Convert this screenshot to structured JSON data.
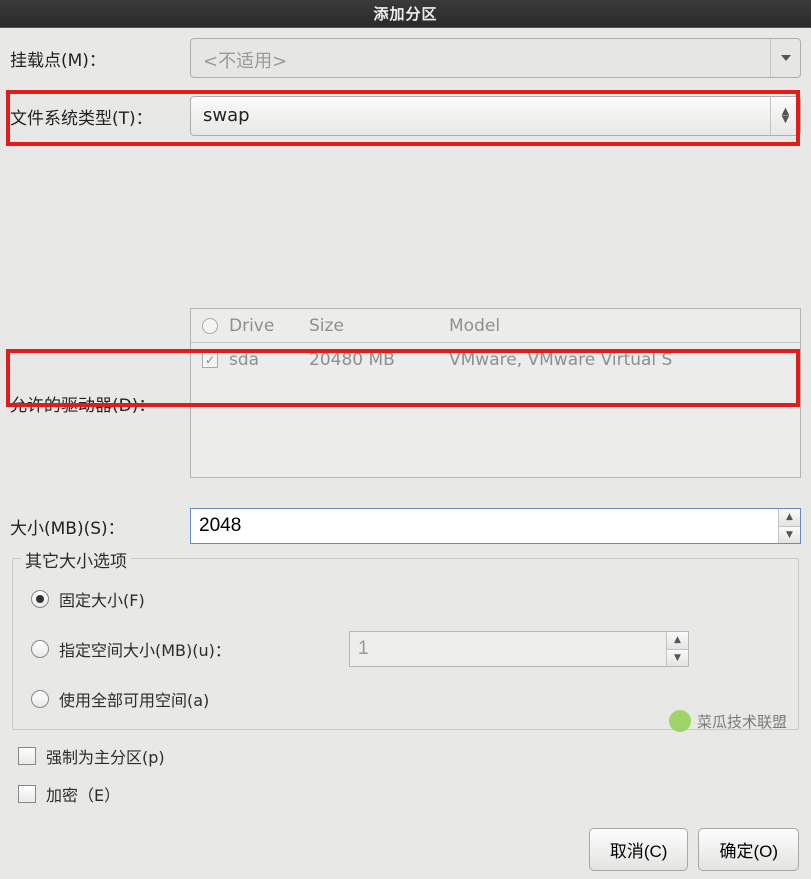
{
  "title": "添加分区",
  "mount": {
    "label": "挂载点(M)：",
    "value": "<不适用>"
  },
  "fs": {
    "label": "文件系统类型(T)：",
    "value": "swap"
  },
  "drives": {
    "label": "允许的驱动器(D)：",
    "headers": {
      "drive": "Drive",
      "size": "Size",
      "model": "Model"
    },
    "rows": [
      {
        "checked": true,
        "drive": "sda",
        "size": "20480 MB",
        "model": "VMware, VMware Virtual S"
      }
    ]
  },
  "size": {
    "label": "大小(MB)(S)：",
    "value": "2048"
  },
  "other_size": {
    "legend": "其它大小选项",
    "fixed": "固定大小(F)",
    "fill_up_to": "指定空间大小(MB)(u)：",
    "fill_max": "使用全部可用空间(a)",
    "fill_up_value": "1",
    "selected": "fixed"
  },
  "force_primary": "强制为主分区(p)",
  "encrypt": "加密（E）",
  "buttons": {
    "cancel": "取消(C)",
    "ok": "确定(O)"
  },
  "watermark": "菜瓜技术联盟"
}
